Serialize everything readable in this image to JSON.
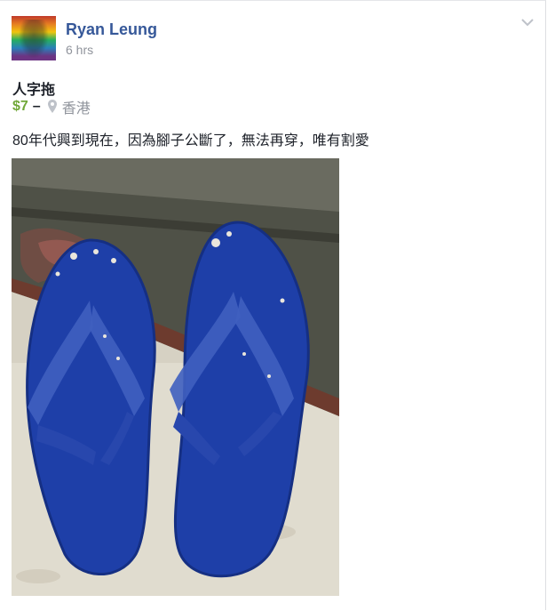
{
  "post": {
    "author": "Ryan Leung",
    "time": "6 hrs",
    "title": "人字拖",
    "price": "$7",
    "separator": "–",
    "location": "香港",
    "description": "80年代興到現在，因為腳子公斷了，無法再穿，唯有割愛"
  },
  "icons": {
    "menu": "chevron-down-icon",
    "location": "location-pin-icon"
  },
  "colors": {
    "author_link": "#365899",
    "price": "#71a839",
    "meta": "#90949c",
    "sandals": "#1e3fa8"
  }
}
